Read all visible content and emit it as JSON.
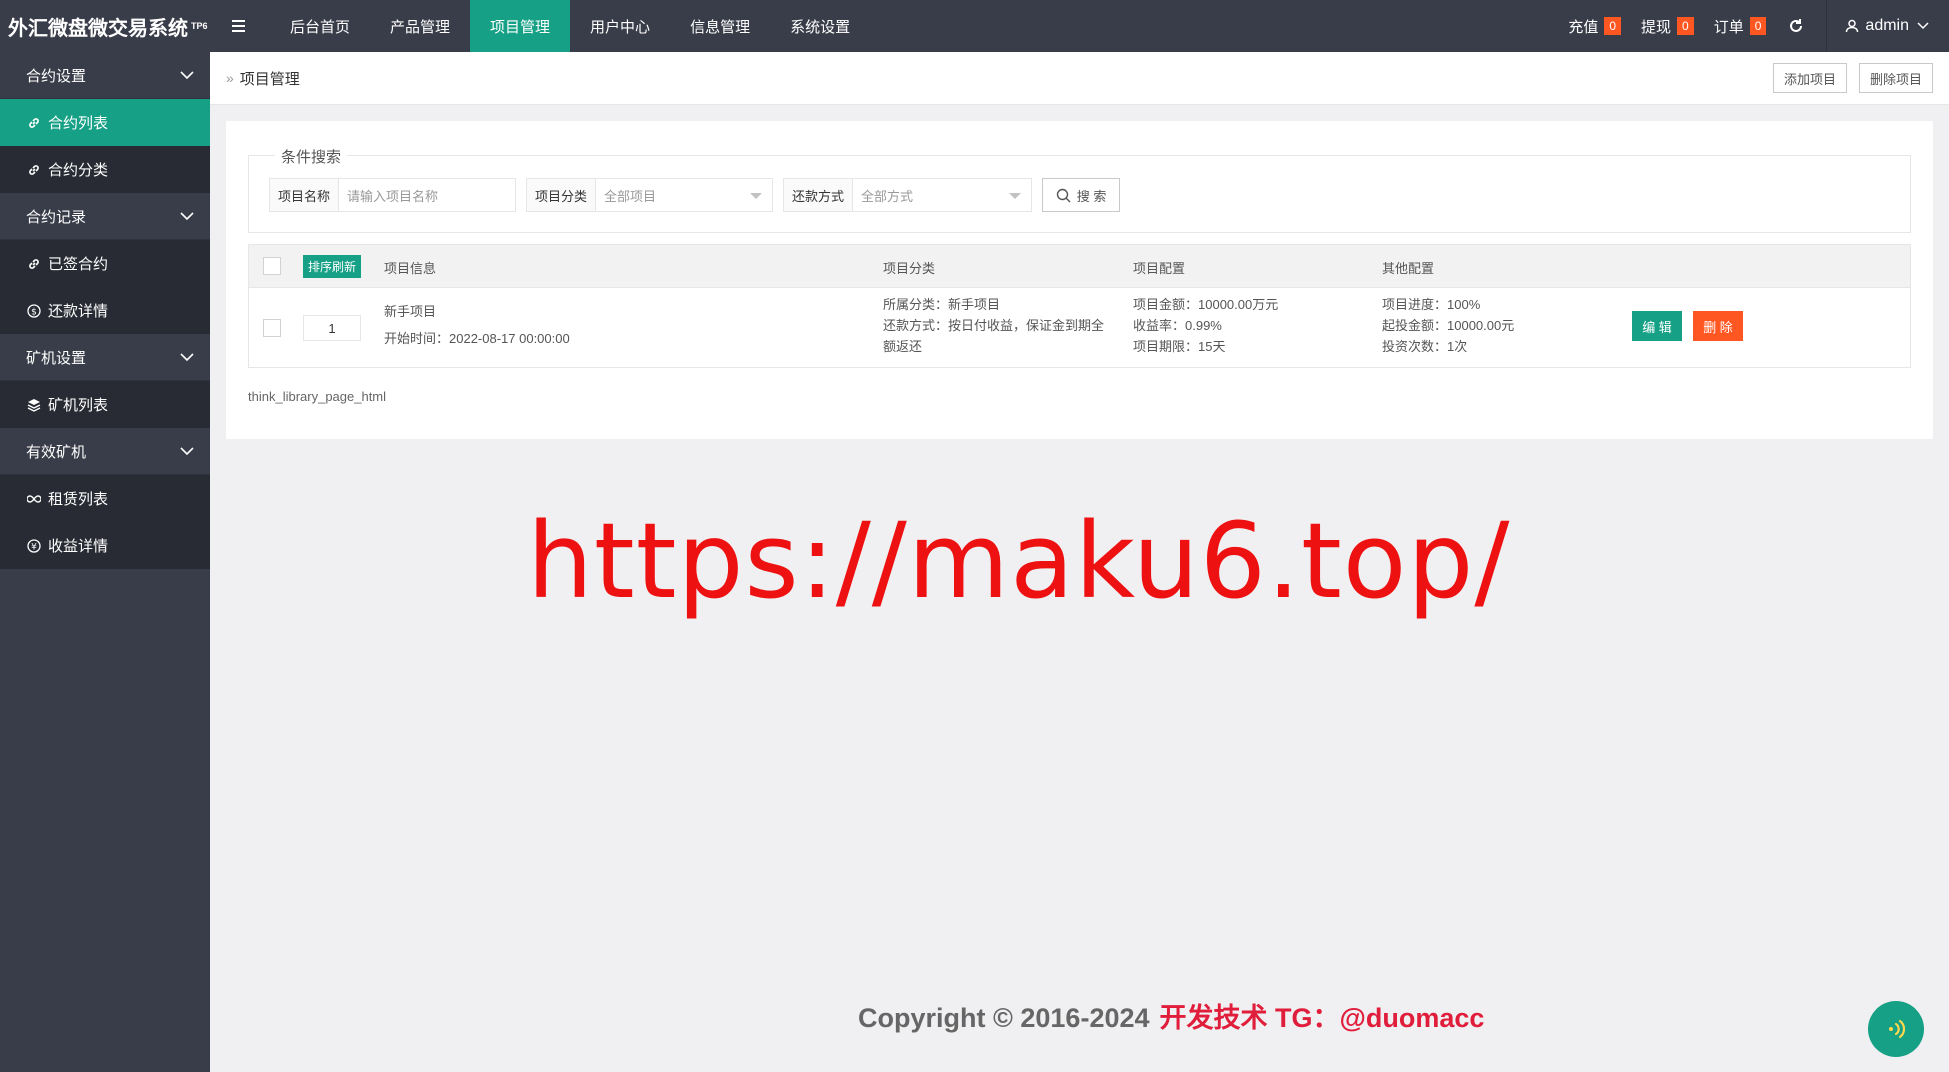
{
  "app": {
    "title": "外汇微盘微交易系统",
    "version": "TP6"
  },
  "topnav": {
    "items": [
      {
        "label": "后台首页"
      },
      {
        "label": "产品管理"
      },
      {
        "label": "项目管理"
      },
      {
        "label": "用户中心"
      },
      {
        "label": "信息管理"
      },
      {
        "label": "系统设置"
      }
    ],
    "active_index": 2
  },
  "topright": {
    "recharge": {
      "label": "充值",
      "count": "0"
    },
    "withdraw": {
      "label": "提现",
      "count": "0"
    },
    "order": {
      "label": "订单",
      "count": "0"
    },
    "user": "admin"
  },
  "sidebar": {
    "group1": {
      "label": "合约设置",
      "items": [
        "合约列表",
        "合约分类"
      ]
    },
    "group2": {
      "label": "合约记录",
      "items": [
        "已签合约",
        "还款详情"
      ]
    },
    "group3": {
      "label": "矿机设置",
      "items": [
        "矿机列表"
      ]
    },
    "group4": {
      "label": "有效矿机",
      "items": [
        "租赁列表",
        "收益详情"
      ]
    }
  },
  "header": {
    "title": "项目管理",
    "add_label": "添加项目",
    "delete_label": "删除项目"
  },
  "search": {
    "legend": "条件搜索",
    "name_label": "项目名称",
    "name_placeholder": "请输入项目名称",
    "category_label": "项目分类",
    "category_value": "全部项目",
    "repay_label": "还款方式",
    "repay_value": "全部方式",
    "button": "搜 索"
  },
  "table": {
    "sort_button": "排序刷新",
    "columns": [
      "项目信息",
      "项目分类",
      "项目配置",
      "其他配置"
    ],
    "rows": [
      {
        "sort": "1",
        "info": [
          "新手项目",
          "开始时间：2022-08-17 00:00:00"
        ],
        "category": [
          "所属分类：新手项目",
          "还款方式：按日付收益，保证金到期全",
          "额返还"
        ],
        "config": [
          "项目金额：10000.00万元",
          "收益率：0.99%",
          "项目期限：15天"
        ],
        "other": [
          "项目进度：100%",
          "起投金额：10000.00元",
          "投资次数：1次"
        ],
        "edit_label": "编 辑",
        "delete_label": "删 除"
      }
    ]
  },
  "pager": "think_library_page_html",
  "watermark": "https://maku6.top/",
  "copyright": {
    "prefix": "Copyright © 2016-2024",
    "dev": "开发技术 TG：@duomacc"
  },
  "colors": {
    "accent": "#16a085",
    "dark": "#393d49",
    "danger": "#ff5722"
  }
}
